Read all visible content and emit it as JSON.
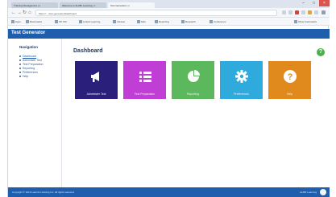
{
  "browser": {
    "tabs": [
      {
        "label": "Training Management | x"
      },
      {
        "label": "Welcome to ALZBr Learning | x"
      },
      {
        "label": "Test Generator | x"
      }
    ],
    "url": "https://..../test-generator/dashboard",
    "bookmarks": [
      "Apps",
      "Bookmarks",
      "CP CM",
      "Linked Learning",
      "Intranet",
      "Mail",
      "Reporting",
      "Research",
      "Conference",
      "Other bookmarks"
    ]
  },
  "app": {
    "title": "Test Generator",
    "sidebar": {
      "heading": "Navigation",
      "items": [
        {
          "label": "Dashboard"
        },
        {
          "label": "Administer Test"
        },
        {
          "label": "Test Preparation"
        },
        {
          "label": "Reporting"
        },
        {
          "label": "Preferences"
        },
        {
          "label": "Help"
        }
      ]
    },
    "main": {
      "title": "Dashboard",
      "tiles": [
        {
          "label": "Administer Test",
          "color": "#2a1f7a",
          "icon": "megaphone-icon"
        },
        {
          "label": "Test Preparation",
          "color": "#c13ed6",
          "icon": "list-icon"
        },
        {
          "label": "Reporting",
          "color": "#5cb85c",
          "icon": "pie-chart-icon"
        },
        {
          "label": "Preferences",
          "color": "#2eaadc",
          "icon": "gear-icon"
        },
        {
          "label": "Help",
          "color": "#e08a1e",
          "icon": "question-icon"
        }
      ]
    },
    "footer": {
      "copyright": "Copyright © 2019 LearnCo training Inc. All rights reserved",
      "right_text": "ALZBr Learning"
    }
  },
  "colors": {
    "header": "#1e5eac",
    "footer": "#1e5eac",
    "help_badge": "#4cae4c"
  }
}
